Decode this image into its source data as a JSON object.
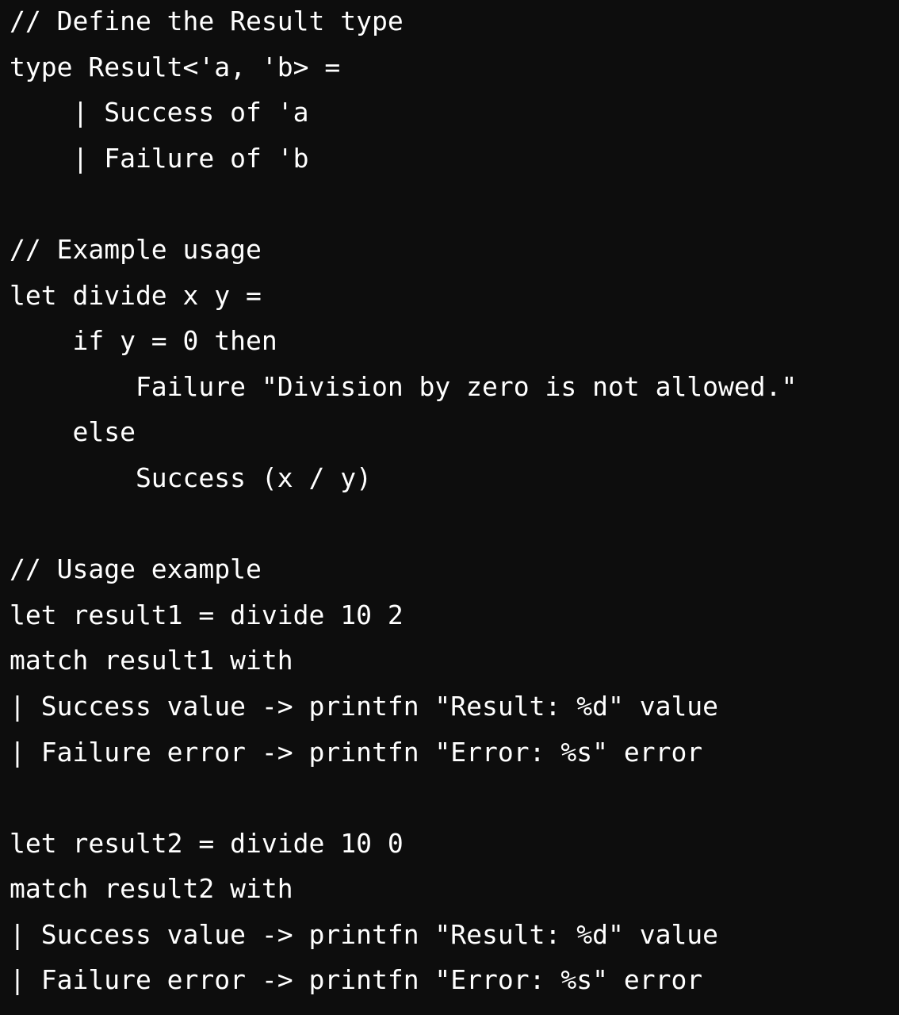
{
  "code": {
    "lines": [
      "// Define the Result type",
      "type Result<'a, 'b> =",
      "    | Success of 'a",
      "    | Failure of 'b",
      "",
      "// Example usage",
      "let divide x y =",
      "    if y = 0 then",
      "        Failure \"Division by zero is not allowed.\"",
      "    else",
      "        Success (x / y)",
      "",
      "// Usage example",
      "let result1 = divide 10 2",
      "match result1 with",
      "| Success value -> printfn \"Result: %d\" value",
      "| Failure error -> printfn \"Error: %s\" error",
      "",
      "let result2 = divide 10 0",
      "match result2 with",
      "| Success value -> printfn \"Result: %d\" value",
      "| Failure error -> printfn \"Error: %s\" error"
    ]
  }
}
